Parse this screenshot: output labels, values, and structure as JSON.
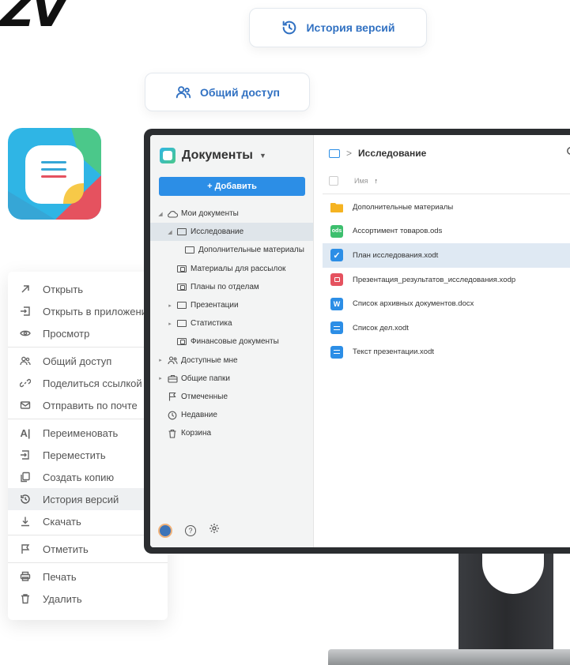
{
  "brand": {
    "logo_text": "ZV"
  },
  "pills": {
    "history": {
      "label": "История версий",
      "icon": "history-icon"
    },
    "sharing": {
      "label": "Общий доступ",
      "icon": "users-icon"
    }
  },
  "context_menu": {
    "items": [
      {
        "label": "Открыть",
        "icon": "arrow-up-right-icon"
      },
      {
        "label": "Открыть в приложении",
        "icon": "open-in-app-icon"
      },
      {
        "label": "Просмотр",
        "icon": "eye-icon"
      },
      {
        "label": "Общий доступ",
        "icon": "users-icon"
      },
      {
        "label": "Поделиться ссылкой",
        "icon": "link-icon"
      },
      {
        "label": "Отправить по почте",
        "icon": "mail-icon"
      },
      {
        "label": "Переименовать",
        "icon": "rename-icon"
      },
      {
        "label": "Переместить",
        "icon": "move-icon"
      },
      {
        "label": "Создать копию",
        "icon": "copy-icon"
      },
      {
        "label": "История версий",
        "icon": "history-icon",
        "highlighted": true
      },
      {
        "label": "Скачать",
        "icon": "download-icon"
      },
      {
        "label": "Отметить",
        "icon": "flag-icon"
      },
      {
        "label": "Печать",
        "icon": "print-icon"
      },
      {
        "label": "Удалить",
        "icon": "trash-icon"
      }
    ]
  },
  "app": {
    "title": "Документы",
    "add_button": "+ Добавить",
    "tree": [
      {
        "label": "Мои документы",
        "icon": "cloud-icon",
        "arrow": "down"
      },
      {
        "label": "Исследование",
        "icon": "folder-icon",
        "arrow": "down",
        "selected": true
      },
      {
        "label": "Дополнительные материалы",
        "icon": "folder-icon",
        "arrow": ""
      },
      {
        "label": "Материалы для рассылок",
        "icon": "shared-folder-icon",
        "arrow": ""
      },
      {
        "label": "Планы по отделам",
        "icon": "shared-folder-icon",
        "arrow": ""
      },
      {
        "label": "Презентации",
        "icon": "folder-icon",
        "arrow": "right"
      },
      {
        "label": "Статистика",
        "icon": "folder-icon",
        "arrow": "right"
      },
      {
        "label": "Финансовые документы",
        "icon": "shared-folder-icon",
        "arrow": ""
      },
      {
        "label": "Доступные мне",
        "icon": "users-icon",
        "arrow": "right"
      },
      {
        "label": "Общие папки",
        "icon": "briefcase-icon",
        "arrow": "right"
      },
      {
        "label": "Отмеченные",
        "icon": "flag-icon",
        "arrow": ""
      },
      {
        "label": "Недавние",
        "icon": "clock-icon",
        "arrow": ""
      },
      {
        "label": "Корзина",
        "icon": "trash-icon",
        "arrow": ""
      }
    ],
    "breadcrumb": {
      "separator": ">",
      "current": "Исследование"
    },
    "column_header": {
      "name": "Имя",
      "sort": "↑"
    },
    "files": [
      {
        "name": "Дополнительные материалы",
        "type": "folder",
        "color": "#f5b321"
      },
      {
        "name": "Ассортимент товаров.ods",
        "type": "ods",
        "badge": "ods",
        "color": "#3dbf6e"
      },
      {
        "name": "План исследования.xodt",
        "type": "checked",
        "color": "#2c8ee6",
        "selected": true
      },
      {
        "name": "Презентация_результатов_исследования.xodp",
        "type": "xodp",
        "color": "#e5525f"
      },
      {
        "name": "Список архивных документов.docx",
        "type": "docx",
        "badge": "W",
        "color": "#2c8ee6"
      },
      {
        "name": "Список дел.xodt",
        "type": "xodt",
        "color": "#2c8ee6"
      },
      {
        "name": "Текст презентации.xodt",
        "type": "xodt",
        "color": "#2c8ee6"
      }
    ]
  }
}
